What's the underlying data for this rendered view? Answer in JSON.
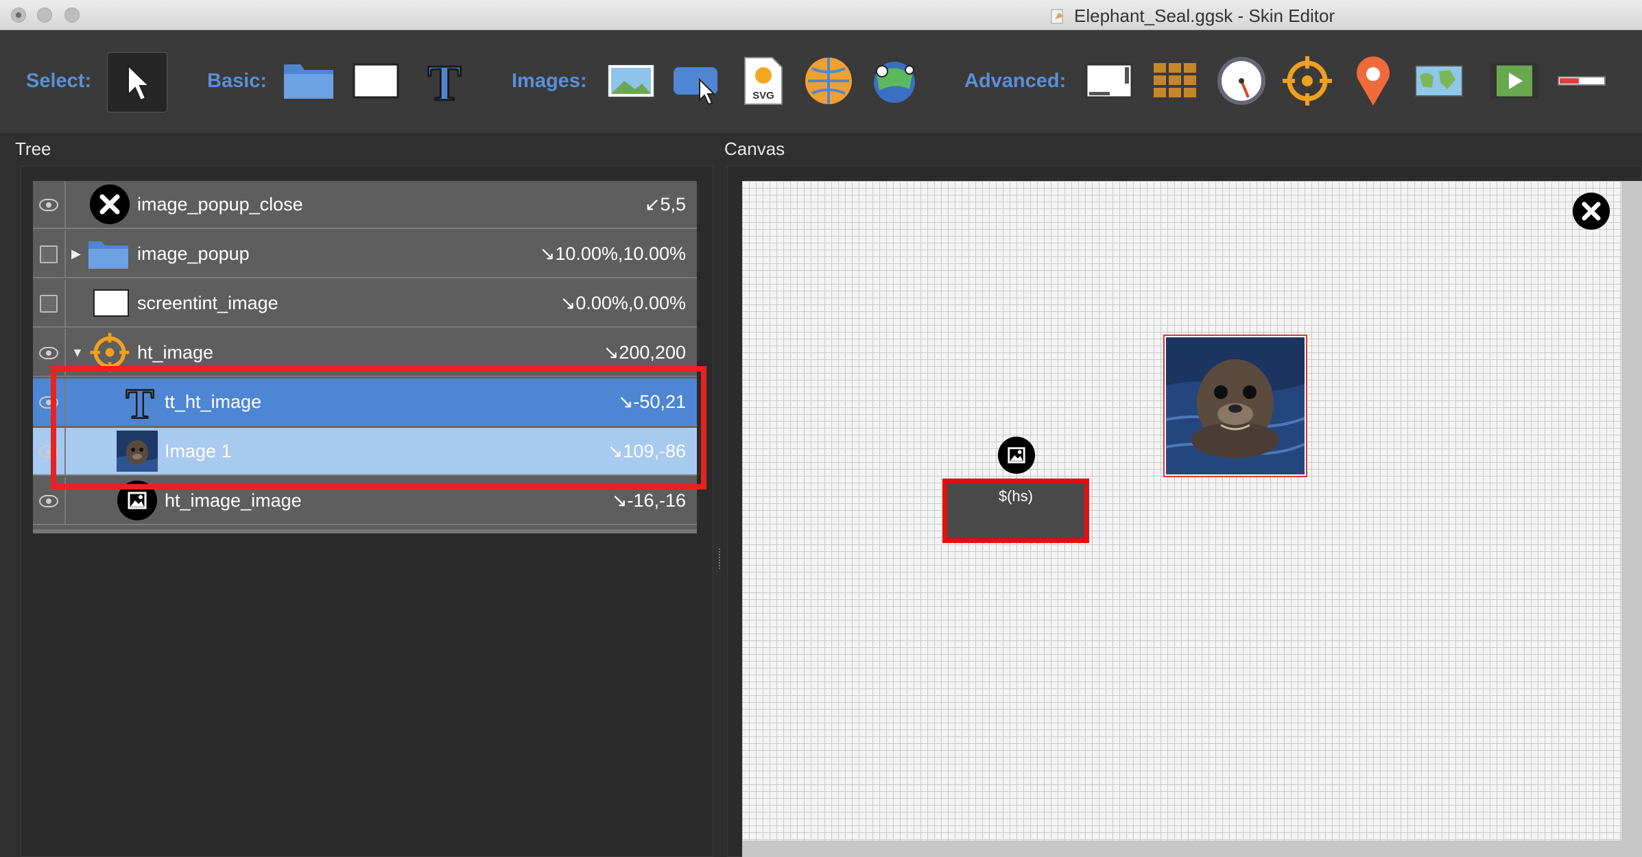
{
  "window": {
    "title": "Elephant_Seal.ggsk - Skin Editor"
  },
  "toolbar": {
    "select_label": "Select:",
    "basic_label": "Basic:",
    "images_label": "Images:",
    "advanced_label": "Advanced:",
    "tools": {
      "select": "pointer-icon",
      "basic": [
        "folder-icon",
        "rectangle-icon",
        "text-icon"
      ],
      "images": [
        "image-icon",
        "image-button-icon",
        "svg-icon",
        "panorama-globe-icon",
        "hotspot-globe-icon"
      ],
      "advanced": [
        "scrollarea-icon",
        "cloner-icon",
        "timer-icon",
        "hotspot-target-icon",
        "map-pin-icon",
        "map-icon",
        "video-icon",
        "progressbar-icon"
      ]
    },
    "svg_label": "SVG"
  },
  "tree": {
    "title": "Tree",
    "rows": [
      {
        "name": "image_popup_close",
        "value": "↙5,5",
        "visibility": "eye",
        "icon": "close-circle-icon",
        "expander": ""
      },
      {
        "name": "image_popup",
        "value": "↘10.00%,10.00%",
        "visibility": "checkbox",
        "icon": "folder-icon",
        "expander": "▶"
      },
      {
        "name": "screentint_image",
        "value": "↘0.00%,0.00%",
        "visibility": "checkbox",
        "icon": "rectangle-icon",
        "expander": ""
      },
      {
        "name": "ht_image",
        "value": "↘200,200",
        "visibility": "eye",
        "icon": "hotspot-target-icon",
        "expander": "▼"
      },
      {
        "name": "tt_ht_image",
        "value": "↘-50,21",
        "visibility": "eye",
        "icon": "text-icon",
        "expander": ""
      },
      {
        "name": "Image 1",
        "value": "↘109,-86",
        "visibility": "eye",
        "icon": "seal-thumbnail-icon",
        "expander": ""
      },
      {
        "name": "ht_image_image",
        "value": "↘-16,-16",
        "visibility": "eye",
        "icon": "image-circle-icon",
        "expander": ""
      }
    ]
  },
  "canvas": {
    "title": "Canvas",
    "hotspot_text": "$(hs)"
  },
  "colors": {
    "accent": "#5b8fd6",
    "selection": "#4f86d3",
    "selection_secondary": "#a8c9f0",
    "highlight": "#e8231f"
  }
}
